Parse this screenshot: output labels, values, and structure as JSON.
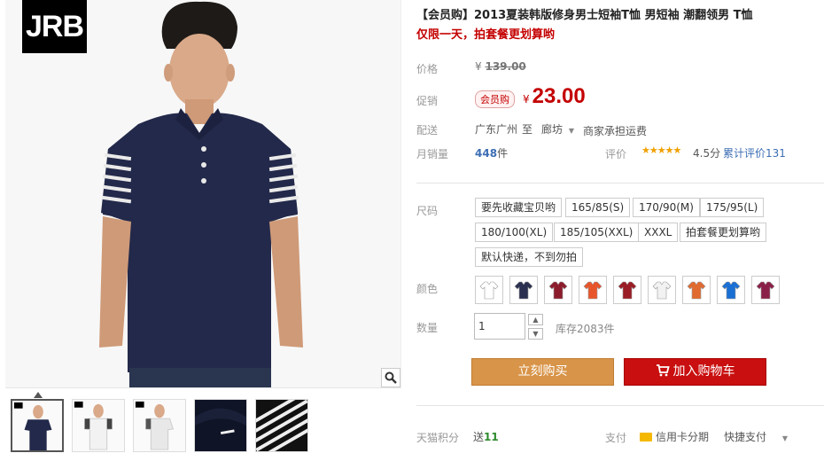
{
  "gallery": {
    "brand_logo_text": "JRB",
    "zoom_icon": "magnifier-icon",
    "thumbnails": [
      "navy-polo",
      "white-polo-front",
      "white-polo-side",
      "collar-detail",
      "sleeve-stripe-detail"
    ],
    "thumbnail_logo": "JRB"
  },
  "product": {
    "title": "【会员购】2013夏装韩版修身男士短袖T恤 男短袖 潮翻领男 T恤",
    "subtitle": "仅限一天，拍套餐更划算哟"
  },
  "price": {
    "label": "价格",
    "currency": "¥",
    "original": "139.00"
  },
  "promo": {
    "label": "促销",
    "badge": "会员购",
    "currency": "¥",
    "price": "23.00"
  },
  "shipping": {
    "label": "配送",
    "from": "广东广州",
    "to_word": "至",
    "to": "廊坊",
    "note": "商家承担运费"
  },
  "sales": {
    "label": "月销量",
    "count": "448",
    "unit": "件",
    "rating_label": "评价",
    "stars": "★★★★★",
    "score": "4.5分",
    "reviews_label": "累计评价",
    "reviews_count": "131"
  },
  "size": {
    "label": "尺码",
    "options": [
      "要先收藏宝贝哟",
      "165/85(S)",
      "170/90(M)",
      "175/95(L)",
      "180/100(XL)",
      "185/105(XXL)",
      "XXXL",
      "拍套餐更划算哟",
      "默认快递，不到勿拍"
    ]
  },
  "color": {
    "label": "颜色",
    "swatches": [
      "#ffffff",
      "#2b3050",
      "#8c1c2c",
      "#e8552a",
      "#9a1c24",
      "#f2f2f2",
      "#e06a30",
      "#1a6fd4",
      "#8a2048"
    ]
  },
  "quantity": {
    "label": "数量",
    "value": "1",
    "stock": "库存2083件"
  },
  "actions": {
    "buy_now": "立刻购买",
    "add_to_cart": "加入购物车"
  },
  "footer": {
    "points_label": "天猫积分",
    "points_prefix": "送",
    "points_value": "11",
    "pay_label": "支付",
    "credit_installment": "信用卡分期",
    "quick_pay": "快捷支付"
  },
  "colors": {
    "accent_red": "#c40000",
    "buy_orange": "#d89448",
    "cart_red": "#c90f0f",
    "link_blue": "#3c6eb4"
  }
}
